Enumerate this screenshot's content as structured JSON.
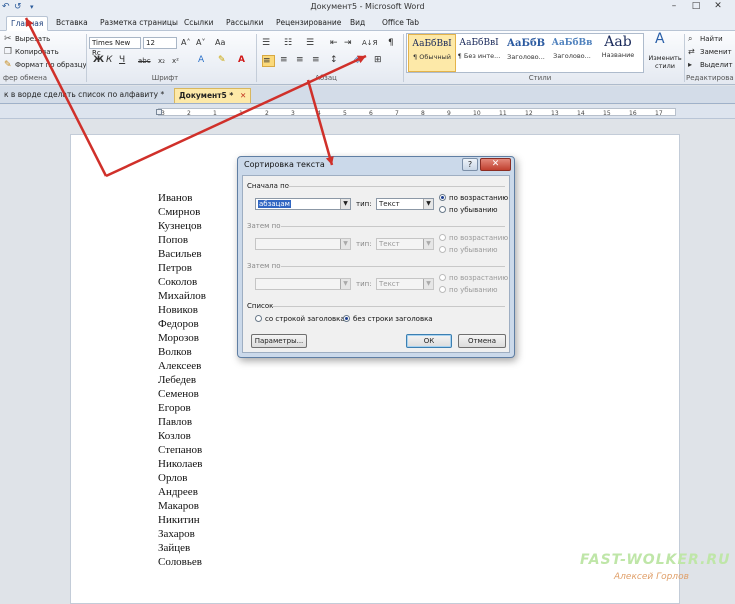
{
  "window": {
    "title": "Документ5 - Microsoft Word",
    "controls": [
      "–",
      "□",
      "✕"
    ]
  },
  "quick_access": {
    "icons": [
      "undo-icon",
      "redo-icon",
      "customize-icon"
    ],
    "glyphs": [
      "↶",
      "↺",
      "▾"
    ]
  },
  "tabs": [
    {
      "label": "Главная",
      "active": true
    },
    {
      "label": "Вставка"
    },
    {
      "label": "Разметка страницы"
    },
    {
      "label": "Ссылки"
    },
    {
      "label": "Рассылки"
    },
    {
      "label": "Рецензирование"
    },
    {
      "label": "Вид"
    },
    {
      "label": "Office Tab"
    }
  ],
  "ribbon": {
    "clipboard": {
      "cut": "Вырезать",
      "copy": "Копировать",
      "format_painter": "Формат по образцу",
      "label": "фер обмена"
    },
    "font": {
      "name": "Times New Rc",
      "size": "12",
      "bold": "Ж",
      "italic": "К",
      "underline": "Ч",
      "label": "Шрифт",
      "grow": "A˄",
      "shrink": "A˅",
      "case": "Aa",
      "strike": "abc",
      "sub": "x₂",
      "sup": "x²",
      "color": "A"
    },
    "paragraph": {
      "label": "Абзац",
      "sort": "А↓Я",
      "pilcrow": "¶"
    },
    "styles": {
      "label": "Стили",
      "items": [
        {
          "sample": "АаБбВвI",
          "name": "¶ Обычный"
        },
        {
          "sample": "АаБбВвI",
          "name": "¶ Без инте..."
        },
        {
          "sample": "АаБбВ",
          "name": "Заголово..."
        },
        {
          "sample": "АаБбВв",
          "name": "Заголово..."
        },
        {
          "sample": "Aab",
          "name": "Название"
        }
      ],
      "change_styles": "Изменить стили"
    },
    "editing": {
      "label": "Редактирова",
      "find": "Найти",
      "replace": "Заменит",
      "select": "Выделит"
    }
  },
  "doc_tabs": [
    {
      "label": "к в ворде сделать список по алфавиту *",
      "active": false
    },
    {
      "label": "Документ5 *",
      "active": true
    }
  ],
  "ruler": {
    "numbers": [
      "3",
      "2",
      "1",
      "1",
      "2",
      "3",
      "4",
      "5",
      "6",
      "7",
      "8",
      "9",
      "10",
      "11",
      "12",
      "13",
      "14",
      "15",
      "16",
      "17"
    ]
  },
  "document": {
    "names": [
      "Иванов",
      "Смирнов",
      "Кузнецов",
      "Попов",
      "Васильев",
      "Петров",
      "Соколов",
      "Михайлов",
      "Новиков",
      "Федоров",
      "Морозов",
      "Волков",
      "Алексеев",
      "Лебедев",
      "Семенов",
      "Егоров",
      "Павлов",
      "Козлов",
      "Степанов",
      "Николаев",
      "Орлов",
      "Андреев",
      "Макаров",
      "Никитин",
      "Захаров",
      "Зайцев",
      "Соловьев"
    ]
  },
  "dialog": {
    "title": "Сортировка текста",
    "help": "?",
    "close": "✕",
    "first": {
      "label": "Сначала по",
      "field": "абзацам",
      "type_label": "тип:",
      "type": "Текст",
      "asc": "по возрастанию",
      "desc": "по убыванию",
      "selected": "asc"
    },
    "then1": {
      "label": "Затем по",
      "type_label": "тип:",
      "type": "Текст",
      "asc": "по возрастанию",
      "desc": "по убыванию"
    },
    "then2": {
      "label": "Затем по",
      "type_label": "тип:",
      "type": "Текст",
      "asc": "по возрастанию",
      "desc": "по убыванию"
    },
    "list": {
      "label": "Список",
      "with_header": "со строкой заголовка",
      "without_header": "без строки заголовка",
      "selected": "without_header"
    },
    "params_button": "Параметры...",
    "ok_button": "ОК",
    "cancel_button": "Отмена"
  },
  "annotation_color": "#d0302a",
  "watermark": {
    "site": "FAST-WOLKER.RU",
    "author": "Алексей Горлов"
  }
}
